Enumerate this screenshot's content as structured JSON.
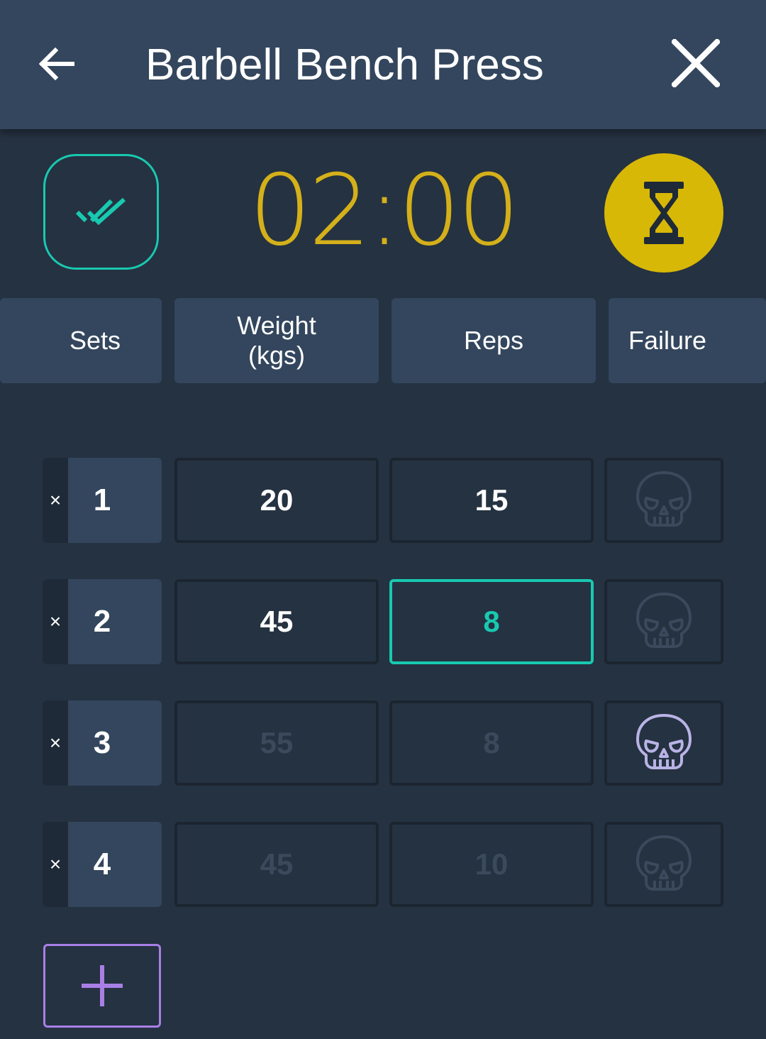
{
  "header": {
    "title": "Barbell Bench Press",
    "back_icon": "arrow-left-icon",
    "close_icon": "close-icon"
  },
  "timer": {
    "display": "02:00",
    "color": "#d4b01a",
    "button_icon": "hourglass-icon",
    "button_color": "#d8b806"
  },
  "done_button": {
    "icon": "double-check-icon",
    "color": "#18c9b0"
  },
  "columns": {
    "sets": "Sets",
    "weight": "Weight\n(kgs)",
    "reps": "Reps",
    "failure": "Failure"
  },
  "sets": [
    {
      "number": "1",
      "weight": "20",
      "reps": "15",
      "weight_state": "filled",
      "reps_state": "filled",
      "failure": false
    },
    {
      "number": "2",
      "weight": "45",
      "reps": "8",
      "weight_state": "filled",
      "reps_state": "active",
      "failure": false
    },
    {
      "number": "3",
      "weight": "55",
      "reps": "8",
      "weight_state": "placeholder",
      "reps_state": "placeholder",
      "failure": true
    },
    {
      "number": "4",
      "weight": "45",
      "reps": "10",
      "weight_state": "placeholder",
      "reps_state": "placeholder",
      "failure": false
    }
  ],
  "remove_symbol": "×",
  "add_button": {
    "icon": "plus-icon",
    "color": "#a97fe6"
  },
  "colors": {
    "background": "#253241",
    "header": "#33465d",
    "accent": "#18c9b0",
    "failure_active": "#b9b3e6",
    "failure_inactive": "#3a4a5c"
  }
}
